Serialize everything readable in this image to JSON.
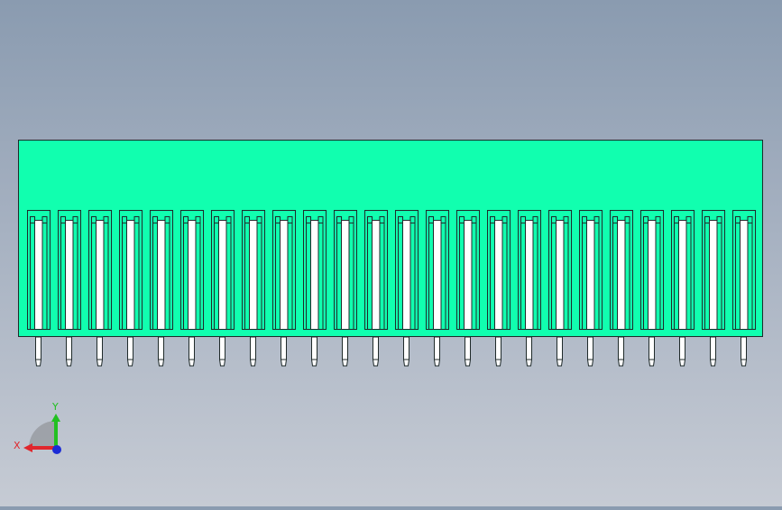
{
  "viewport": {
    "background_top": "#8a9bb0",
    "background_bottom": "#c6cbd4"
  },
  "model": {
    "name": "connector",
    "body_color": "#11ffaf",
    "outline_color": "#1f2a2a",
    "slot_fill": "#ffffff",
    "pin_color": "#ffffff",
    "pin_count": 24
  },
  "triad": {
    "x_label": "X",
    "y_label": "Y",
    "x_color": "#e0262c",
    "y_color": "#22c021",
    "z_color": "#1b2bd6"
  }
}
